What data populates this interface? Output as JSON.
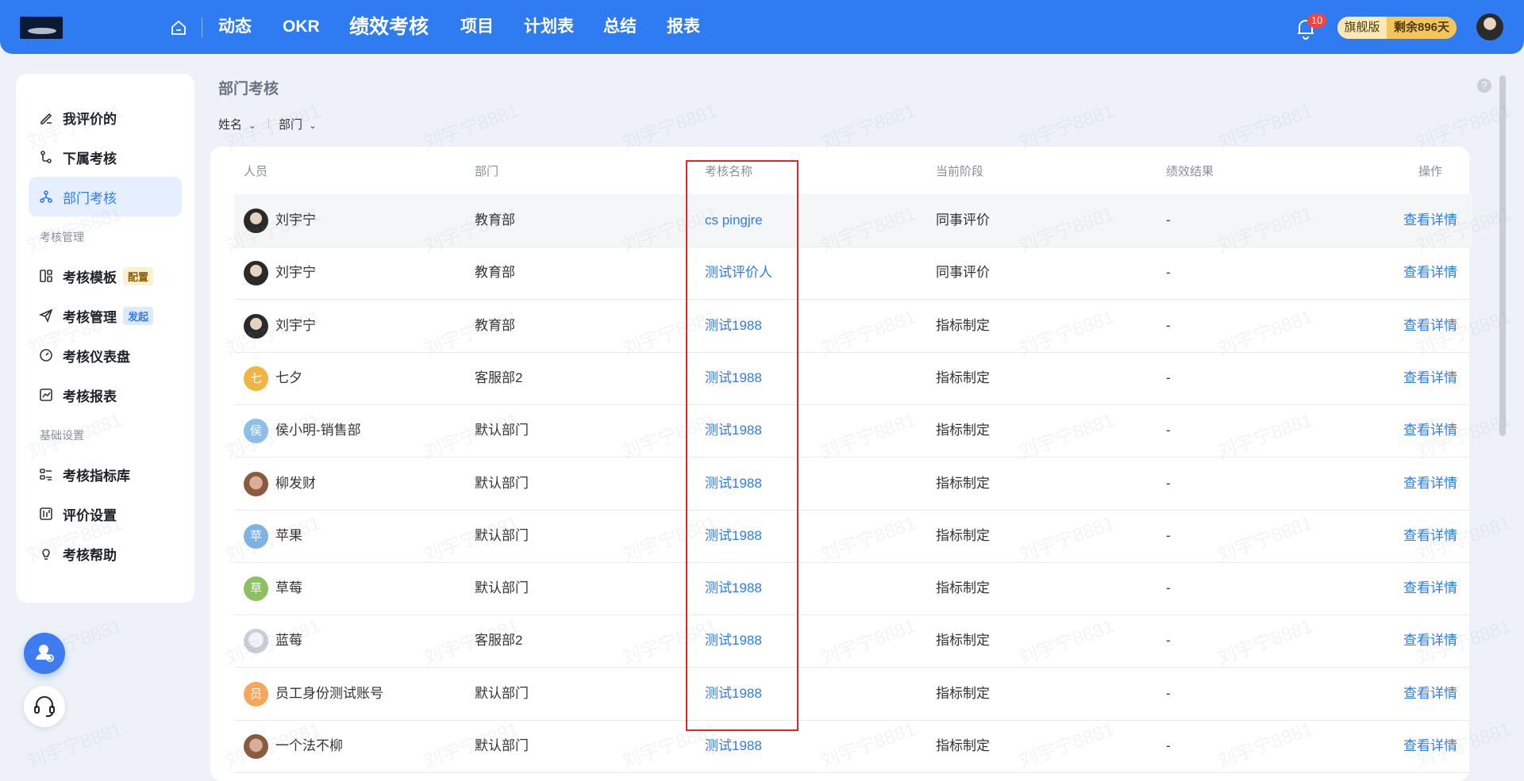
{
  "topbar": {
    "nav": [
      "动态",
      "OKR",
      "绩效考核",
      "项目",
      "计划表",
      "总结",
      "报表"
    ],
    "active_nav": "绩效考核",
    "notification_count": "10",
    "plan_edition": "旗舰版",
    "plan_remaining": "剩余896天"
  },
  "sidebar": {
    "items_top": [
      {
        "label": "我评价的",
        "icon": "edit-icon"
      },
      {
        "label": "下属考核",
        "icon": "subordinate-icon"
      },
      {
        "label": "部门考核",
        "icon": "org-tree-icon",
        "active": true
      }
    ],
    "group1_title": "考核管理",
    "items_group1": [
      {
        "label": "考核模板",
        "icon": "template-icon",
        "tag": "配置"
      },
      {
        "label": "考核管理",
        "icon": "send-icon",
        "tag": "发起"
      },
      {
        "label": "考核仪表盘",
        "icon": "gauge-icon"
      },
      {
        "label": "考核报表",
        "icon": "report-icon"
      }
    ],
    "group2_title": "基础设置",
    "items_group2": [
      {
        "label": "考核指标库",
        "icon": "indicator-library-icon"
      },
      {
        "label": "评价设置",
        "icon": "settings-icon"
      },
      {
        "label": "考核帮助",
        "icon": "lightbulb-icon"
      }
    ]
  },
  "main": {
    "title": "部门考核",
    "filters": [
      "姓名",
      "部门"
    ],
    "columns": [
      "人员",
      "部门",
      "考核名称",
      "当前阶段",
      "绩效结果",
      "操作"
    ],
    "rows": [
      {
        "name": "刘宇宁",
        "dept": "教育部",
        "review": "cs pingjre",
        "stage": "同事评价",
        "result": "-",
        "action": "查看详情",
        "avatar": "photo"
      },
      {
        "name": "刘宇宁",
        "dept": "教育部",
        "review": "测试评价人",
        "stage": "同事评价",
        "result": "-",
        "action": "查看详情",
        "avatar": "photo"
      },
      {
        "name": "刘宇宁",
        "dept": "教育部",
        "review": "测试1988",
        "stage": "指标制定",
        "result": "-",
        "action": "查看详情",
        "avatar": "photo"
      },
      {
        "name": "七夕",
        "dept": "客服部2",
        "review": "测试1988",
        "stage": "指标制定",
        "result": "-",
        "action": "查看详情",
        "avatar": "七",
        "color": "#f2b441"
      },
      {
        "name": "侯小明-销售部",
        "dept": "默认部门",
        "review": "测试1988",
        "stage": "指标制定",
        "result": "-",
        "action": "查看详情",
        "avatar": "侯",
        "color": "#8cc0ea"
      },
      {
        "name": "柳发财",
        "dept": "默认部门",
        "review": "测试1988",
        "stage": "指标制定",
        "result": "-",
        "action": "查看详情",
        "avatar": "photo2"
      },
      {
        "name": "苹果",
        "dept": "默认部门",
        "review": "测试1988",
        "stage": "指标制定",
        "result": "-",
        "action": "查看详情",
        "avatar": "苹",
        "color": "#7fb3e6"
      },
      {
        "name": "草莓",
        "dept": "默认部门",
        "review": "测试1988",
        "stage": "指标制定",
        "result": "-",
        "action": "查看详情",
        "avatar": "草",
        "color": "#8cc063"
      },
      {
        "name": "蓝莓",
        "dept": "客服部2",
        "review": "测试1988",
        "stage": "指标制定",
        "result": "-",
        "action": "查看详情",
        "avatar": "photo3"
      },
      {
        "name": "员工身份测试账号",
        "dept": "默认部门",
        "review": "测试1988",
        "stage": "指标制定",
        "result": "-",
        "action": "查看详情",
        "avatar": "员",
        "color": "#f6a65a"
      },
      {
        "name": "一个法不柳",
        "dept": "默认部门",
        "review": "测试1988",
        "stage": "指标制定",
        "result": "-",
        "action": "查看详情",
        "avatar": "photo2"
      }
    ]
  },
  "watermark": "刘宇宁8881",
  "colors": {
    "primary": "#2e7bf2",
    "highlight_box": "#e4262b",
    "badge": "#f5433f"
  }
}
